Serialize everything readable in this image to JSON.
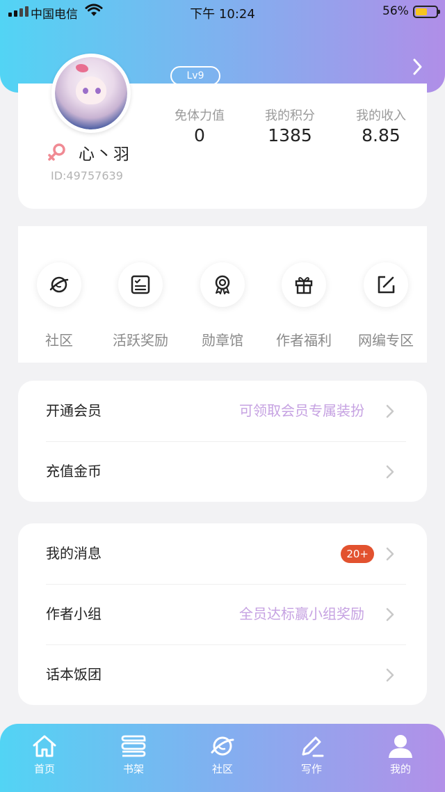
{
  "status_bar": {
    "carrier": "中国电信",
    "time": "下午 10:24",
    "battery_percent": "56%",
    "battery_level": 0.56,
    "battery_color": "#f7c51e"
  },
  "profile": {
    "level": "Lv9",
    "username": "心丶羽",
    "user_id": "ID:49757639",
    "gender_icon": "female-icon",
    "stats": [
      {
        "label": "免体力值",
        "value": "0"
      },
      {
        "label": "我的积分",
        "value": "1385"
      },
      {
        "label": "我的收入",
        "value": "8.85"
      }
    ]
  },
  "shortcuts": [
    {
      "label": "社区",
      "icon": "planet-icon"
    },
    {
      "label": "活跃奖励",
      "icon": "checklist-icon"
    },
    {
      "label": "勋章馆",
      "icon": "medal-icon"
    },
    {
      "label": "作者福利",
      "icon": "gift-icon"
    },
    {
      "label": "网编专区",
      "icon": "edit-icon"
    }
  ],
  "menu_group_1": [
    {
      "label": "开通会员",
      "hint": "可领取会员专属装扮"
    },
    {
      "label": "充值金币",
      "hint": ""
    }
  ],
  "menu_group_2": [
    {
      "label": "我的消息",
      "hint": "",
      "badge": "20+"
    },
    {
      "label": "作者小组",
      "hint": "全员达标赢小组奖励"
    },
    {
      "label": "话本饭团",
      "hint": ""
    }
  ],
  "tabbar": [
    {
      "label": "首页",
      "icon": "home-icon"
    },
    {
      "label": "书架",
      "icon": "bookshelf-icon"
    },
    {
      "label": "社区",
      "icon": "planet-icon"
    },
    {
      "label": "写作",
      "icon": "pen-icon"
    },
    {
      "label": "我的",
      "icon": "user-icon"
    }
  ],
  "colors": {
    "accent_hint": "#c6a2e2",
    "badge": "#e2522f",
    "gradient_start": "#52d4f4",
    "gradient_end": "#b08ee8"
  }
}
